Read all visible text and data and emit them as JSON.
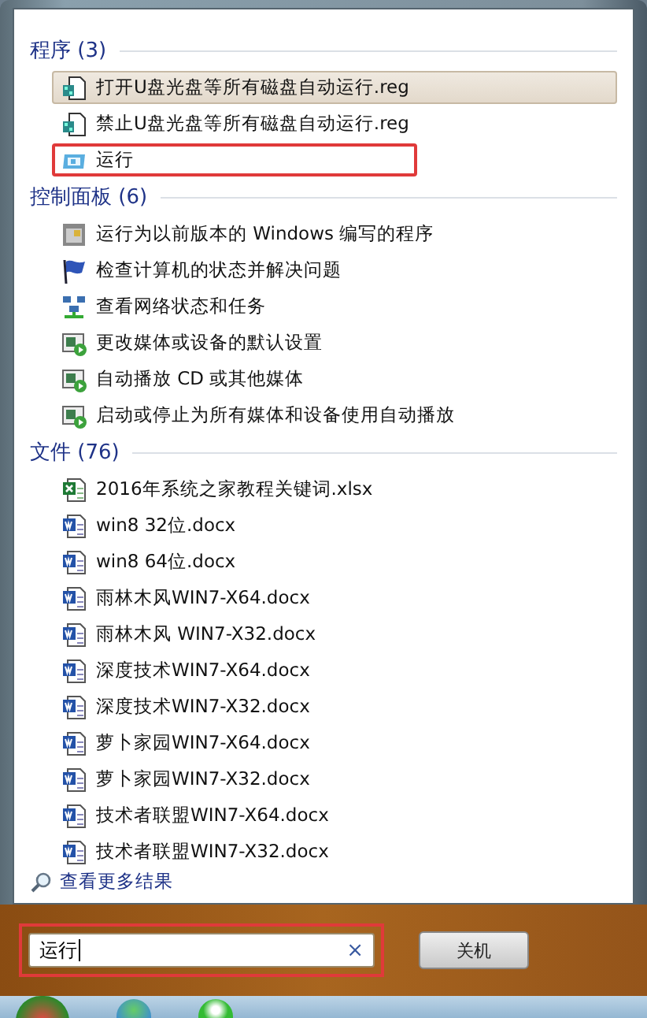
{
  "groups": [
    {
      "title": "程序",
      "count": "(3)",
      "items": [
        {
          "label": "打开U盘光盘等所有磁盘自动运行.reg",
          "kind": "reg",
          "hovered": true,
          "marked": false
        },
        {
          "label": "禁止U盘光盘等所有磁盘自动运行.reg",
          "kind": "reg",
          "hovered": false,
          "marked": false
        },
        {
          "label": "运行",
          "kind": "run",
          "hovered": false,
          "marked": true
        }
      ]
    },
    {
      "title": "控制面板",
      "count": "(6)",
      "items": [
        {
          "label": "运行为以前版本的 Windows 编写的程序",
          "kind": "compat",
          "hovered": false,
          "marked": false
        },
        {
          "label": "检查计算机的状态并解决问题",
          "kind": "flag",
          "hovered": false,
          "marked": false
        },
        {
          "label": "查看网络状态和任务",
          "kind": "network",
          "hovered": false,
          "marked": false
        },
        {
          "label": "更改媒体或设备的默认设置",
          "kind": "autoplay",
          "hovered": false,
          "marked": false
        },
        {
          "label": "自动播放 CD 或其他媒体",
          "kind": "autoplay",
          "hovered": false,
          "marked": false
        },
        {
          "label": "启动或停止为所有媒体和设备使用自动播放",
          "kind": "autoplay",
          "hovered": false,
          "marked": false
        }
      ]
    },
    {
      "title": "文件",
      "count": "(76)",
      "items": [
        {
          "label": "2016年系统之家教程关键词.xlsx",
          "kind": "xlsx",
          "hovered": false,
          "marked": false
        },
        {
          "label": "win8 32位.docx",
          "kind": "docx",
          "hovered": false,
          "marked": false
        },
        {
          "label": "win8 64位.docx",
          "kind": "docx",
          "hovered": false,
          "marked": false
        },
        {
          "label": "雨林木风WIN7-X64.docx",
          "kind": "docx",
          "hovered": false,
          "marked": false
        },
        {
          "label": "雨林木风 WIN7-X32.docx",
          "kind": "docx",
          "hovered": false,
          "marked": false
        },
        {
          "label": "深度技术WIN7-X64.docx",
          "kind": "docx",
          "hovered": false,
          "marked": false
        },
        {
          "label": "深度技术WIN7-X32.docx",
          "kind": "docx",
          "hovered": false,
          "marked": false
        },
        {
          "label": "萝卜家园WIN7-X64.docx",
          "kind": "docx",
          "hovered": false,
          "marked": false
        },
        {
          "label": "萝卜家园WIN7-X32.docx",
          "kind": "docx",
          "hovered": false,
          "marked": false
        },
        {
          "label": "技术者联盟WIN7-X64.docx",
          "kind": "docx",
          "hovered": false,
          "marked": false
        },
        {
          "label": "技术者联盟WIN7-X32.docx",
          "kind": "docx",
          "hovered": false,
          "marked": false
        }
      ]
    }
  ],
  "more_results": "查看更多结果",
  "search": {
    "value": "运行",
    "clear": "×",
    "marked": true
  },
  "shutdown": {
    "label": "关机"
  }
}
